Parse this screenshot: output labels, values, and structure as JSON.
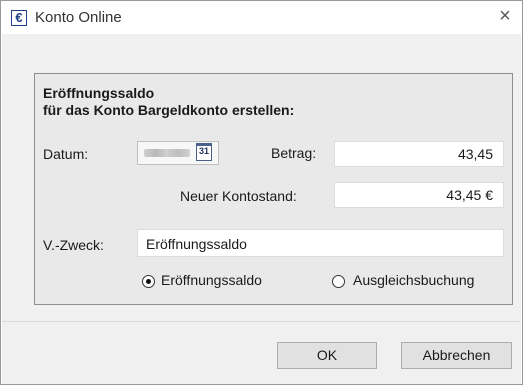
{
  "window": {
    "title": "Konto Online",
    "close_glyph": "×",
    "app_icon_glyph": "€"
  },
  "group": {
    "heading_line1": "Eröffnungssaldo",
    "heading_line2": "für das Konto Bargeldkonto erstellen:",
    "datum_label": "Datum:",
    "calendar_day": "31",
    "betrag_label": "Betrag:",
    "betrag_value": "43,45",
    "kontostand_label": "Neuer Kontostand:",
    "kontostand_value": "43,45 €",
    "zweck_label": "V.-Zweck:",
    "zweck_value": "Eröffnungssaldo",
    "radio_options": [
      {
        "label": "Eröffnungssaldo",
        "checked": true
      },
      {
        "label": "Ausgleichsbuchung",
        "checked": false
      }
    ]
  },
  "buttons": {
    "ok": "OK",
    "cancel": "Abbrechen"
  }
}
